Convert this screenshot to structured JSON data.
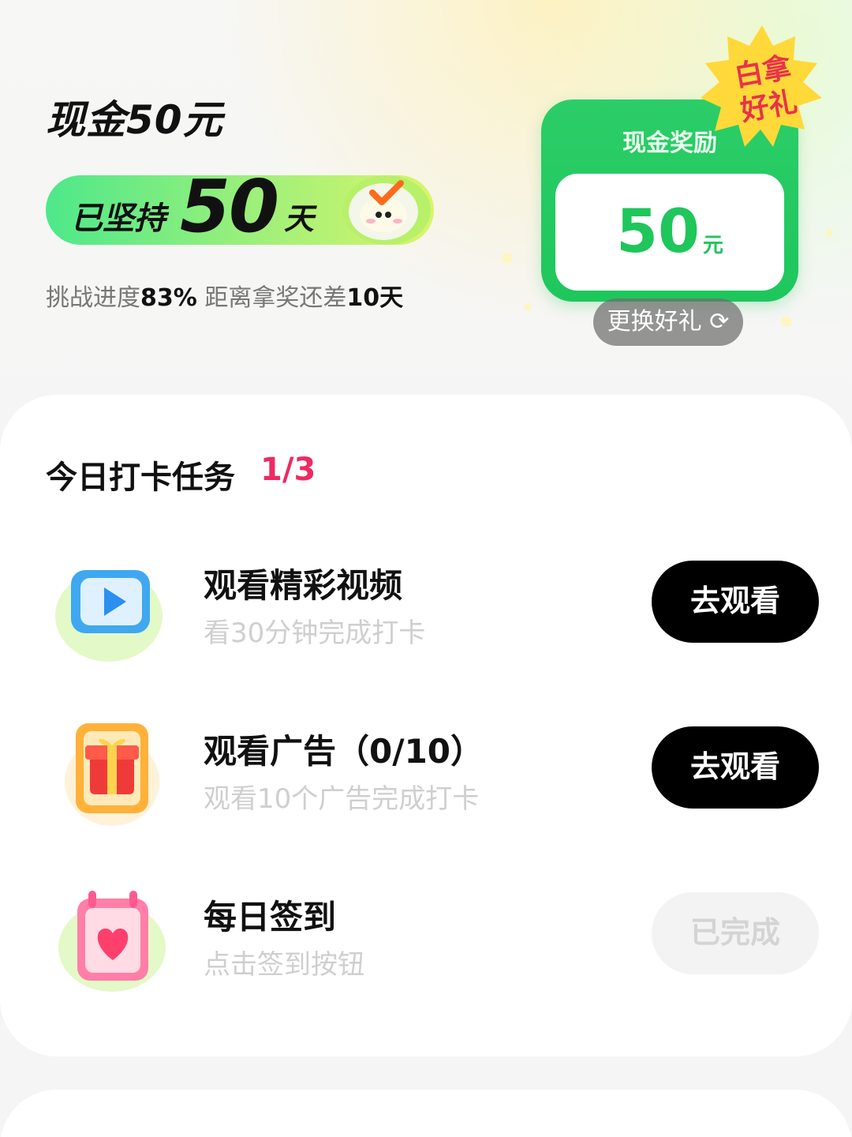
{
  "header": {
    "title": "现金50元",
    "streak_prefix": "已坚持",
    "streak_days": "50",
    "streak_unit": "天",
    "progress_label": "挑战进度",
    "progress_value": "83%",
    "remaining_label": "距离拿奖还差",
    "remaining_value": "10天"
  },
  "reward": {
    "label": "现金奖励",
    "amount": "50",
    "unit": "元",
    "badge_line1": "白拿",
    "badge_line2": "好礼",
    "change_button": "更换好礼 ⟳"
  },
  "tasks": {
    "title": "今日打卡任务",
    "count": "1/3",
    "items": [
      {
        "name": "观看精彩视频",
        "desc": "看30分钟完成打卡",
        "button": "去观看",
        "icon": "video-play-icon"
      },
      {
        "name": "观看广告（0/10）",
        "desc": "观看10个广告完成打卡",
        "button": "去观看",
        "icon": "gift-box-icon"
      },
      {
        "name": "每日签到",
        "desc": "点击签到按钮",
        "button": "已完成",
        "icon": "calendar-heart-icon"
      }
    ]
  },
  "colors": {
    "accent_green": "#1fc65b",
    "count_pink": "#ee2a63",
    "badge_yellow": "#ffd93a"
  }
}
